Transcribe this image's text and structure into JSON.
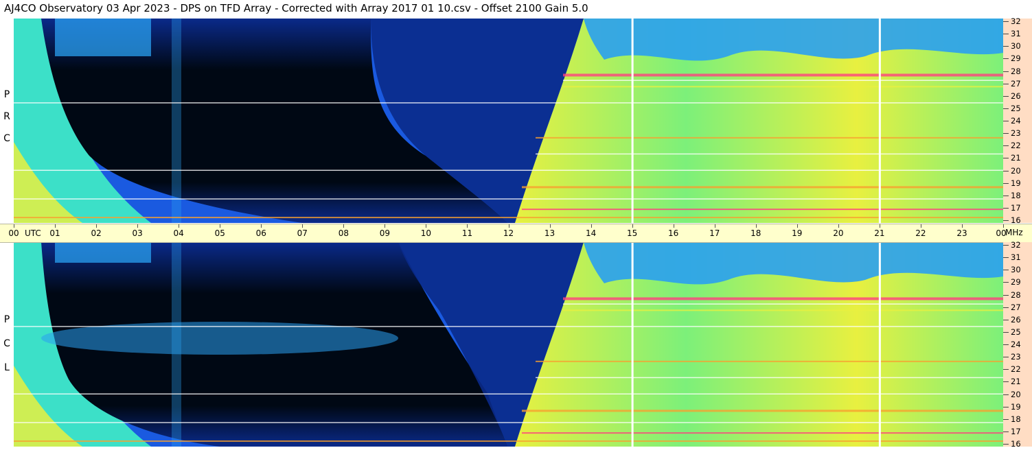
{
  "title": "AJ4CO Observatory  03 Apr 2023  -  DPS on TFD Array  -  Corrected with Array 2017 01 10.csv  -  Offset 2100  Gain 5.0",
  "axis": {
    "utc_label": "UTC",
    "mhz_label": "MHz",
    "time_ticks": [
      "00",
      "01",
      "02",
      "03",
      "04",
      "05",
      "06",
      "07",
      "08",
      "09",
      "10",
      "11",
      "12",
      "13",
      "14",
      "15",
      "16",
      "17",
      "18",
      "19",
      "20",
      "21",
      "22",
      "23",
      "00"
    ],
    "freq_ticks": [
      "32",
      "31",
      "30",
      "29",
      "28",
      "27",
      "26",
      "25",
      "24",
      "23",
      "22",
      "21",
      "20",
      "19",
      "18",
      "17",
      "16"
    ]
  },
  "panels": [
    {
      "id": "rcp",
      "letters": [
        "R",
        "C",
        "P"
      ]
    },
    {
      "id": "lcp",
      "letters": [
        "L",
        "C",
        "P"
      ]
    }
  ],
  "chart_data": {
    "type": "heatmap",
    "title": "AJ4CO Observatory  03 Apr 2023  -  DPS on TFD Array  -  Corrected with Array 2017 01 10.csv  -  Offset 2100  Gain 5.0",
    "x": {
      "label": "UTC",
      "range": [
        0,
        24
      ],
      "unit": "hours"
    },
    "y": {
      "label": "MHz",
      "range": [
        16,
        32
      ]
    },
    "panels": [
      "RCP",
      "LCP"
    ],
    "colorscale": [
      "#000814",
      "#0a2a8a",
      "#1a5ae0",
      "#2aa0f0",
      "#3ce0c8",
      "#7cf07a",
      "#e8f040",
      "#f8a030",
      "#ff4080",
      "#ffffff"
    ],
    "vertical_markers_utc": [
      15,
      21
    ]
  }
}
